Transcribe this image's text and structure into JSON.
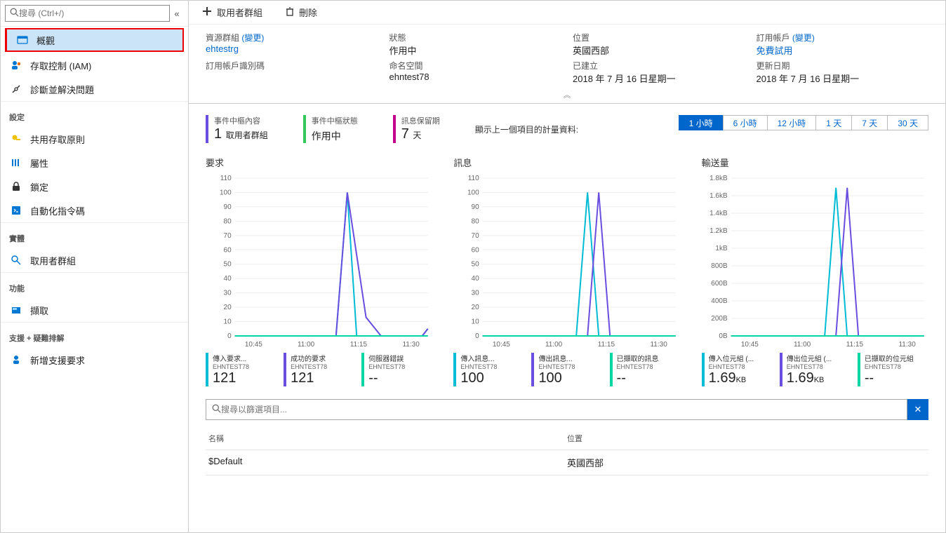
{
  "sidebar": {
    "search_placeholder": "搜尋 (Ctrl+/)",
    "menu": {
      "overview": "概觀",
      "iam": "存取控制 (IAM)",
      "diagnose": "診斷並解決問題"
    },
    "section_settings": "設定",
    "settings": {
      "shared_access": "共用存取原則",
      "properties": "屬性",
      "locks": "鎖定",
      "automation": "自動化指令碼"
    },
    "section_entities": "實體",
    "entities": {
      "consumer_groups": "取用者群組"
    },
    "section_features": "功能",
    "features": {
      "capture": "擷取"
    },
    "section_support": "支援 + 疑難排解",
    "support": {
      "new_request": "新增支援要求"
    }
  },
  "toolbar": {
    "add_consumer_group": "取用者群組",
    "delete": "刪除"
  },
  "info": {
    "resource_group_label": "資源群組",
    "resource_group_value": "ehtestrg",
    "change": "(變更)",
    "status_label": "狀態",
    "status_value": "作用中",
    "location_label": "位置",
    "location_value": "英國西部",
    "subscription_label": "訂用帳戶",
    "subscription_value": "免費試用",
    "sub_id_label": "訂用帳戶識別碼",
    "namespace_label": "命名空間",
    "namespace_value": "ehntest78",
    "created_label": "已建立",
    "created_value": "2018 年 7 月 16 日星期一",
    "updated_label": "更新日期",
    "updated_value": "2018 年 7 月 16 日星期一"
  },
  "stats": {
    "content_label": "事件中樞內容",
    "content_value": "1",
    "content_unit": "取用者群組",
    "status_label": "事件中樞狀態",
    "status_value": "作用中",
    "retention_label": "訊息保留期",
    "retention_value": "7",
    "retention_unit": "天",
    "metrics_label": "顯示上一個項目的計量資料:",
    "ranges": [
      "1 小時",
      "6 小時",
      "12 小時",
      "1 天",
      "7 天",
      "30 天"
    ]
  },
  "charts_titles": {
    "requests": "要求",
    "messages": "訊息",
    "throughput": "輸送量"
  },
  "chart_data": [
    {
      "type": "line",
      "title": "要求",
      "xticks": [
        "10:45",
        "11:00",
        "11:15",
        "11:30"
      ],
      "yticks": [
        0,
        10,
        20,
        30,
        40,
        50,
        60,
        70,
        80,
        90,
        100,
        110
      ],
      "ylim": [
        0,
        110
      ],
      "series": [
        {
          "name": "傳入要求...",
          "sub": "EHNTEST78",
          "color": "#00bcd4",
          "value": "121",
          "points": [
            [
              0,
              0
            ],
            [
              54,
              0
            ],
            [
              60,
              100
            ],
            [
              65,
              0
            ],
            [
              100,
              0
            ],
            [
              103,
              5
            ]
          ]
        },
        {
          "name": "成功的要求",
          "sub": "EHNTEST78",
          "color": "#6a4ee0",
          "value": "121",
          "points": [
            [
              0,
              0
            ],
            [
              54,
              0
            ],
            [
              60,
              100
            ],
            [
              70,
              13
            ],
            [
              78,
              0
            ],
            [
              100,
              0
            ],
            [
              103,
              5
            ]
          ]
        },
        {
          "name": "伺服器錯誤",
          "sub": "EHNTEST78",
          "color": "#00d6a4",
          "value": "--",
          "points": [
            [
              0,
              0
            ],
            [
              103,
              0
            ]
          ]
        }
      ]
    },
    {
      "type": "line",
      "title": "訊息",
      "xticks": [
        "10:45",
        "11:00",
        "11:15",
        "11:30"
      ],
      "yticks": [
        0,
        10,
        20,
        30,
        40,
        50,
        60,
        70,
        80,
        90,
        100,
        110
      ],
      "ylim": [
        0,
        110
      ],
      "series": [
        {
          "name": "傳入訊息...",
          "sub": "EHNTEST78",
          "color": "#00bcd4",
          "value": "100",
          "points": [
            [
              0,
              0
            ],
            [
              50,
              0
            ],
            [
              56,
              100
            ],
            [
              62,
              0
            ],
            [
              103,
              0
            ]
          ]
        },
        {
          "name": "傳出訊息...",
          "sub": "EHNTEST78",
          "color": "#6a4ee0",
          "value": "100",
          "points": [
            [
              0,
              0
            ],
            [
              56,
              0
            ],
            [
              62,
              100
            ],
            [
              68,
              0
            ],
            [
              103,
              0
            ]
          ]
        },
        {
          "name": "已擷取的訊息",
          "sub": "EHNTEST78",
          "color": "#00d6a4",
          "value": "--",
          "points": [
            [
              0,
              0
            ],
            [
              103,
              0
            ]
          ]
        }
      ]
    },
    {
      "type": "line",
      "title": "輸送量",
      "xticks": [
        "10:45",
        "11:00",
        "11:15",
        "11:30"
      ],
      "yticklabels": [
        "0B",
        "200B",
        "400B",
        "600B",
        "800B",
        "1kB",
        "1.2kB",
        "1.4kB",
        "1.6kB",
        "1.8kB"
      ],
      "ylim": [
        0,
        1800
      ],
      "series": [
        {
          "name": "傳入位元組 (...",
          "sub": "EHNTEST78",
          "color": "#00bcd4",
          "value": "1.69",
          "unit": "KB",
          "points": [
            [
              0,
              0
            ],
            [
              50,
              0
            ],
            [
              56,
              1690
            ],
            [
              62,
              0
            ],
            [
              103,
              0
            ]
          ]
        },
        {
          "name": "傳出位元組 (...",
          "sub": "EHNTEST78",
          "color": "#6a4ee0",
          "value": "1.69",
          "unit": "KB",
          "points": [
            [
              0,
              0
            ],
            [
              56,
              0
            ],
            [
              62,
              1690
            ],
            [
              68,
              0
            ],
            [
              103,
              0
            ]
          ]
        },
        {
          "name": "已擷取的位元組",
          "sub": "EHNTEST78",
          "color": "#00d6a4",
          "value": "--",
          "points": [
            [
              0,
              0
            ],
            [
              103,
              0
            ]
          ]
        }
      ]
    }
  ],
  "filter": {
    "placeholder": "搜尋以篩選項目..."
  },
  "table": {
    "col_name": "名稱",
    "col_location": "位置",
    "rows": [
      {
        "name": "$Default",
        "location": "英國西部"
      }
    ]
  }
}
